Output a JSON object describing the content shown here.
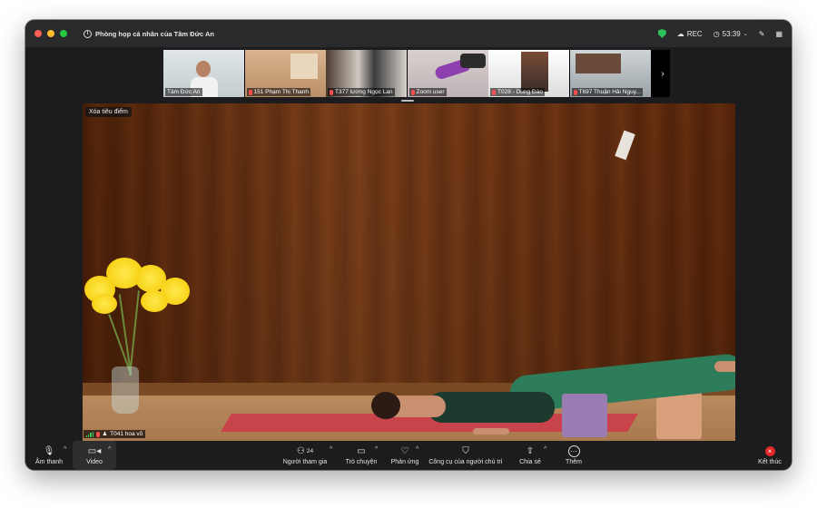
{
  "titlebar": {
    "meeting_title": "Phòng họp cá nhân của Tâm Đức An",
    "rec_label": "REC",
    "timer": "53:39"
  },
  "participants_strip": [
    {
      "name": "Tâm Đức An",
      "muted": false
    },
    {
      "name": "151 Phạm Thị Thanh",
      "muted": true
    },
    {
      "name": "T377 lương Ngọc Lan",
      "muted": true
    },
    {
      "name": "Zoom user",
      "muted": true
    },
    {
      "name": "T028 - Dung Đào",
      "muted": true
    },
    {
      "name": "T697 Thuận Hải Nguy...",
      "muted": true
    }
  ],
  "main_video": {
    "clear_focus_label": "Xóa tiêu điểm",
    "speaker_name": "T041 hoa võ"
  },
  "toolbar": {
    "audio_label": "Âm thanh",
    "video_label": "Video",
    "participants_label": "Người tham gia",
    "participants_count": "24",
    "chat_label": "Trò chuyện",
    "reactions_label": "Phản ứng",
    "host_tools_label": "Công cụ của người chủ trì",
    "share_label": "Chia sẻ",
    "more_label": "Thêm",
    "end_label": "Kết thúc"
  },
  "colors": {
    "window_bg": "#1c1c1e",
    "titlebar_bg": "#2a2a2c",
    "end_red": "#e02828",
    "secure_green": "#2fc25b"
  }
}
